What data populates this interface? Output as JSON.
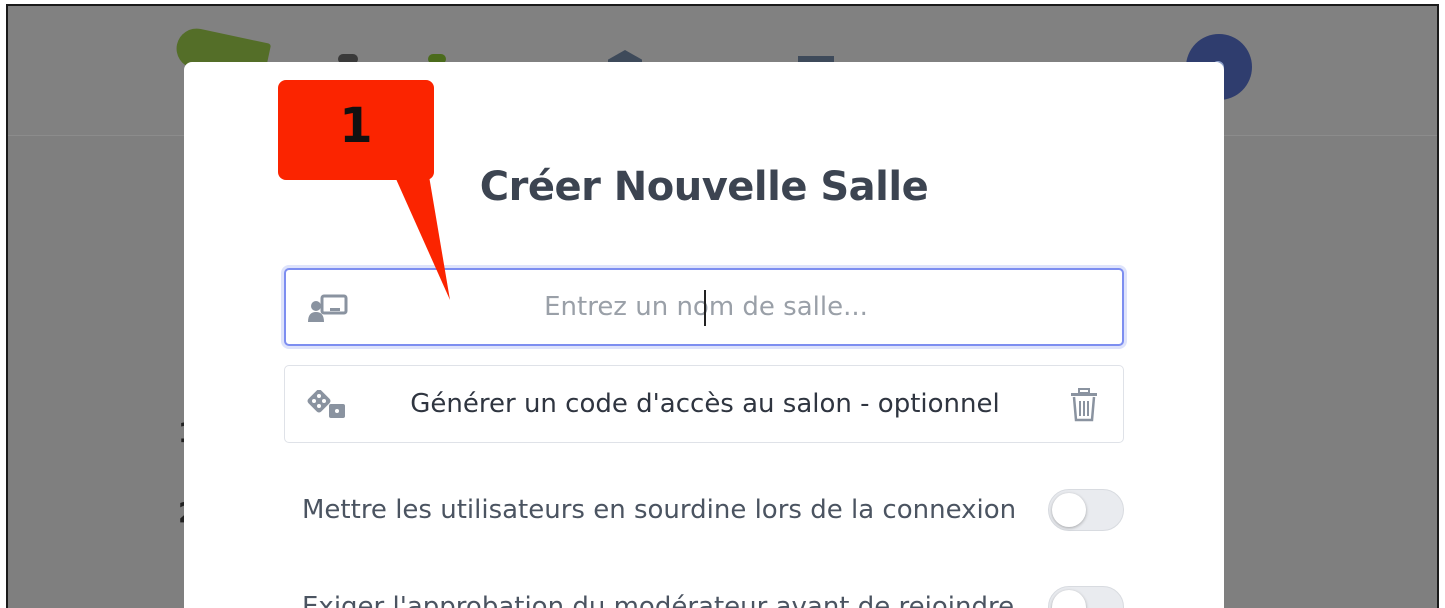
{
  "modal": {
    "title": "Créer Nouvelle Salle",
    "room_name": {
      "value": "",
      "placeholder": "Entrez un nom de salle...",
      "icon": "presenter-icon"
    },
    "access_code": {
      "label": "Générer un code d'accès au salon - optionnel",
      "icon": "dice-icon",
      "delete_icon": "trash-icon"
    },
    "options": [
      {
        "label": "Mettre les utilisateurs en sourdine lors de la connexion",
        "enabled": false
      },
      {
        "label": "Exiger l'approbation du modérateur avant de rejoindre",
        "enabled": false
      }
    ]
  },
  "annotation": {
    "label": "1",
    "color": "#fb2400"
  },
  "colors": {
    "accent_focus": "#7d8ef0",
    "overlay": "#7f7f7f",
    "title": "#3c4451"
  }
}
